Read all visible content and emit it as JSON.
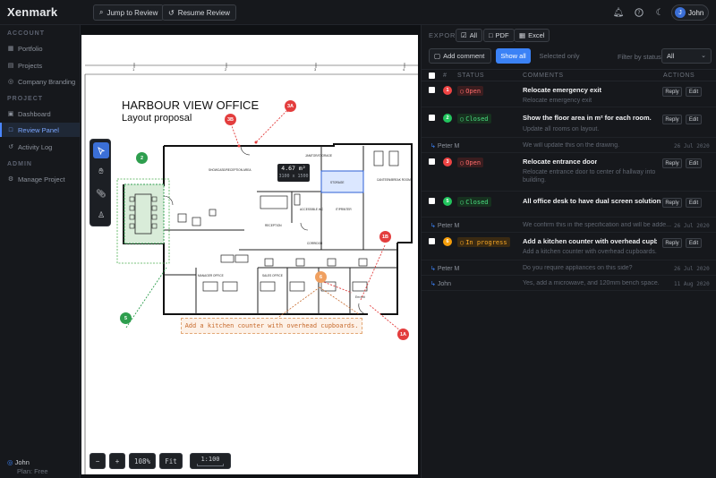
{
  "app": {
    "logo": "Xenmark"
  },
  "topbar": {
    "jump_label": "Jump to Review",
    "resume_label": "Resume Review",
    "user_initial": "J",
    "user_name": "John"
  },
  "sidebar": {
    "section_account": "ACCOUNT",
    "section_project": "PROJECT",
    "section_admin": "ADMIN",
    "items": [
      {
        "label": "Portfolio",
        "icon": "portfolio-icon"
      },
      {
        "label": "Projects",
        "icon": "projects-icon"
      },
      {
        "label": "Company Branding",
        "icon": "branding-icon"
      },
      {
        "label": "Dashboard",
        "icon": "dashboard-icon"
      },
      {
        "label": "Review Panel",
        "icon": "review-icon"
      },
      {
        "label": "Activity Log",
        "icon": "activity-icon"
      },
      {
        "label": "Manage Project",
        "icon": "manage-icon"
      }
    ],
    "user_name": "John",
    "plan": "Plan: Free"
  },
  "canvas": {
    "drawing_title": "HARBOUR VIEW OFFICE",
    "drawing_subtitle": "Layout proposal",
    "area_value": "4.67 m²",
    "area_sub": "3100 x 1500",
    "annotation_text": "Add a kitchen counter with overhead cupboards.",
    "room_labels": {
      "showcase": "SHOWCASE/RECEPTION AREA",
      "janitor": "JANITOR/STORAGE",
      "canteen": "CANTEEN/BREAK ROOM",
      "storage": "STORAGE",
      "accessible": "ACCESSIBLE WC",
      "printer": "IT/PRINTER",
      "reception": "RECEPTION",
      "corridor": "CORRIDOR",
      "manager": "MANAGER OFFICE",
      "sales": "SALES OFFICE",
      "em_exit": "Em exit"
    },
    "ruler_ticks": [
      "1",
      "2",
      "3",
      "4"
    ],
    "pins": [
      "3B",
      "3A",
      "2",
      "1B",
      "6",
      "5",
      "1A"
    ],
    "zoom_out": "−",
    "zoom_in": "+",
    "zoom_level": "108%",
    "fit": "Fit",
    "scale": "1:100"
  },
  "panel": {
    "export_label": "EXPORT",
    "export_all": "All",
    "export_pdf": "PDF",
    "export_excel": "Excel",
    "add_comment": "Add comment",
    "show_all": "Show all",
    "selected_only": "Selected only",
    "filter_label": "Filter by status",
    "filter_value": "All",
    "headers": {
      "num": "#",
      "status": "STATUS",
      "comments": "COMMENTS",
      "actions": "ACTIONS"
    },
    "reply_label": "Reply",
    "edit_label": "Edit",
    "comments": [
      {
        "num": "1",
        "status": "Open",
        "title": "Relocate emergency exit",
        "sub": "Relocate emergency exit"
      },
      {
        "num": "2",
        "status": "Closed",
        "title": "Show the floor area in m² for each room.",
        "sub": "Update all rooms on layout."
      },
      {
        "num": "3",
        "status": "Open",
        "title": "Relocate entrance door",
        "sub": "Relocate entrance door to center of hallway into building."
      },
      {
        "num": "5",
        "status": "Closed",
        "title": "All office desk to have dual screen solutions.",
        "sub": ""
      },
      {
        "num": "6",
        "status": "In progress",
        "title": "Add a kitchen counter with overhead cupb...",
        "sub": "Add a kitchen counter with overhead cupboards."
      }
    ],
    "replies": [
      {
        "who": "Peter M",
        "msg": "We will update this on the drawing.",
        "date": "26 Jul 2020"
      },
      {
        "who": "Peter M",
        "msg": "We confirm this in the specification and will be adde...",
        "date": "26 Jul 2020"
      },
      {
        "who": "Peter M",
        "msg": "Do you require appliances on this side?",
        "date": "26 Jul 2020"
      },
      {
        "who": "John",
        "msg": "Yes, add a microwave, and 120mm bench space.",
        "date": "11 Aug 2020"
      }
    ]
  },
  "colors": {
    "accent": "#3b82f6",
    "open": "#ef4444",
    "closed": "#22c55e",
    "in_progress": "#f59e0b"
  }
}
